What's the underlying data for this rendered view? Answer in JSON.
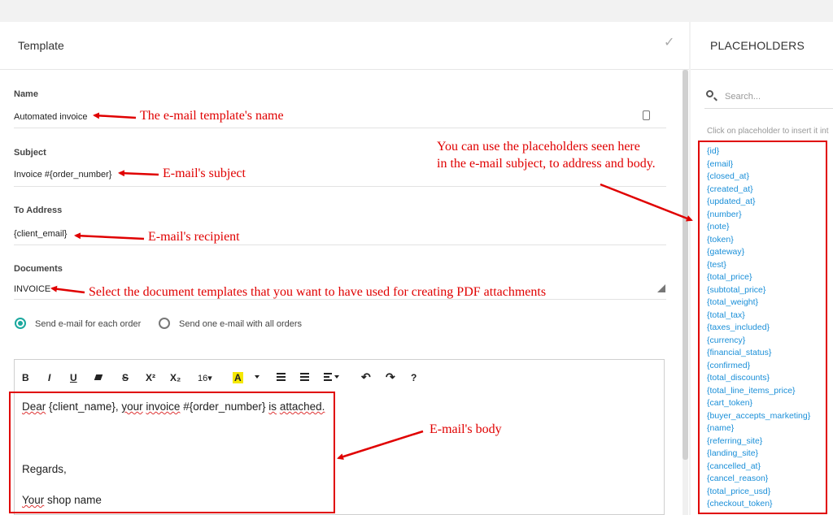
{
  "header": {
    "title": "Template",
    "placeholders_title": "PLACEHOLDERS"
  },
  "form": {
    "name_label": "Name",
    "name_value": "Automated invoice",
    "subject_label": "Subject",
    "subject_value": "Invoice #{order_number}",
    "to_label": "To Address",
    "to_value": "{client_email}",
    "documents_label": "Documents",
    "documents_value": "INVOICE",
    "radio_each": "Send e-mail for each order",
    "radio_one": "Send one e-mail with all orders",
    "radio_selected": "each"
  },
  "toolbar": {
    "bold": "B",
    "italic": "I",
    "underline": "U",
    "strike": "S",
    "superscript": "X²",
    "subscript": "X₂",
    "font_size": "16▾",
    "font_color": "A",
    "help": "?"
  },
  "editor": {
    "line1_dear": "Dear",
    "line1_var1": "{client_name}",
    "line1_comma": ",",
    "line1_your": "your",
    "line1_invoice": "invoice",
    "line1_var2": "#{order_number}",
    "line1_is": "is",
    "line1_attached": "attached.",
    "line2": "Regards,",
    "line3_your": "Your",
    "line3_rest": "shop name"
  },
  "sidebar": {
    "search_placeholder": "Search...",
    "hint": "Click on placeholder to insert it int",
    "placeholders": [
      "{id}",
      "{email}",
      "{closed_at}",
      "{created_at}",
      "{updated_at}",
      "{number}",
      "{note}",
      "{token}",
      "{gateway}",
      "{test}",
      "{total_price}",
      "{subtotal_price}",
      "{total_weight}",
      "{total_tax}",
      "{taxes_included}",
      "{currency}",
      "{financial_status}",
      "{confirmed}",
      "{total_discounts}",
      "{total_line_items_price}",
      "{cart_token}",
      "{buyer_accepts_marketing}",
      "{name}",
      "{referring_site}",
      "{landing_site}",
      "{cancelled_at}",
      "{cancel_reason}",
      "{total_price_usd}",
      "{checkout_token}"
    ]
  },
  "annotations": {
    "name": "The e-mail template's name",
    "subject": "E-mail's subject",
    "recipient": "E-mail's recipient",
    "documents": "Select the document templates that you want to have used for creating PDF attachments",
    "placeholders_line1": "You can use the placeholders seen here",
    "placeholders_line2": "in the e-mail subject, to address and body.",
    "body": "E-mail's body"
  },
  "colors": {
    "annotation_red": "#e00000",
    "accent_teal": "#1ba89e",
    "link_blue": "#1a8fd8"
  }
}
